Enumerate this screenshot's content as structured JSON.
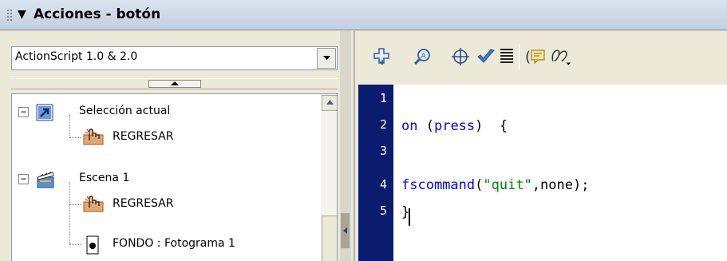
{
  "panel": {
    "title": "Acciones - botón",
    "collapse_glyph": "▼"
  },
  "script_selector": {
    "selected": "ActionScript 1.0 & 2.0"
  },
  "tree": {
    "items": [
      {
        "label": "Selección actual",
        "icon": "current-selection-icon",
        "expander": "−"
      },
      {
        "label": "REGRESAR",
        "icon": "button-symbol-icon"
      },
      {
        "label": "Escena 1",
        "icon": "scene-clapper-icon",
        "expander": "−"
      },
      {
        "label": "REGRESAR",
        "icon": "button-symbol-icon"
      },
      {
        "label": "FONDO : Fotograma 1",
        "icon": "frame-icon"
      }
    ]
  },
  "toolbar": {
    "buttons": [
      "add-action-icon",
      "find-icon",
      "target-icon",
      "check-syntax-icon",
      "auto-format-icon",
      "code-hint-icon",
      "debug-options-icon"
    ]
  },
  "editor": {
    "line_numbers": [
      "1",
      "2",
      "3",
      "4",
      "5"
    ],
    "lines": [
      [],
      [
        {
          "t": "on",
          "c": "kw"
        },
        {
          "t": " ("
        },
        {
          "t": "press",
          "c": "kw"
        },
        {
          "t": ")  {"
        }
      ],
      [],
      [
        {
          "t": "fscommand",
          "c": "kw"
        },
        {
          "t": "("
        },
        {
          "t": "\"quit\"",
          "c": "str"
        },
        {
          "t": ",none);"
        }
      ],
      [
        {
          "t": "}"
        }
      ]
    ]
  },
  "colors": {
    "keyword": "#0000ff",
    "string": "#008000",
    "gutter": "#0b1b6e"
  }
}
